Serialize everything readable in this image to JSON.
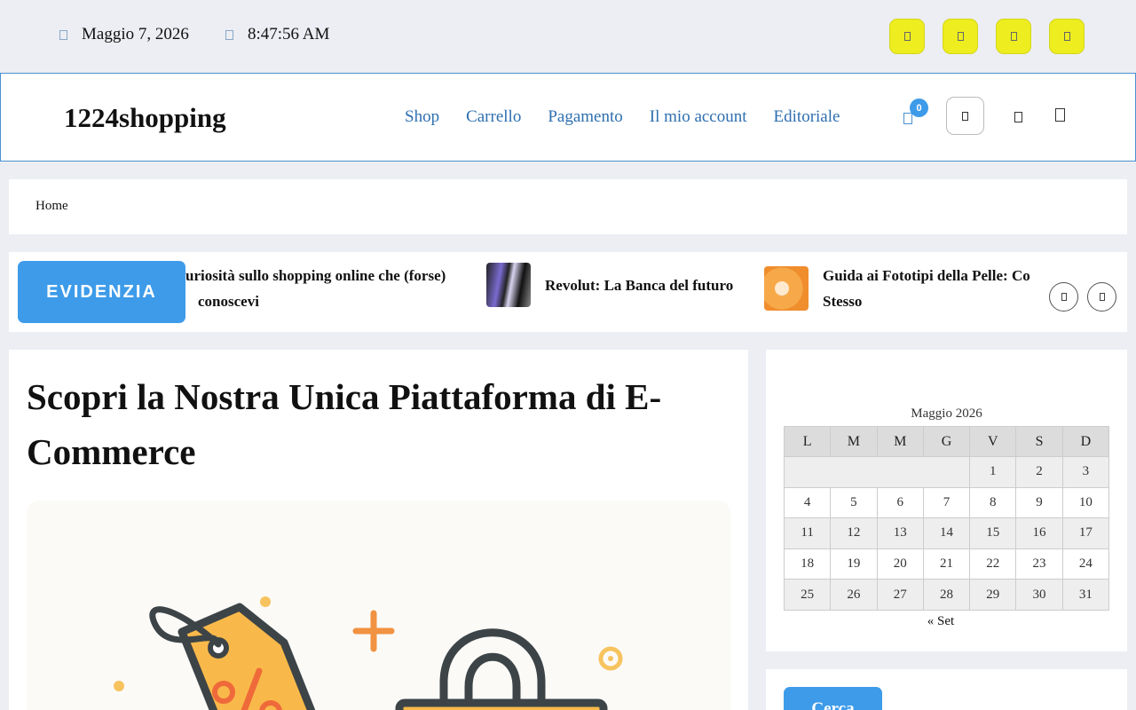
{
  "topbar": {
    "date": "Maggio 7, 2026",
    "time": "8:47:56 AM",
    "date_icon": "calendar-icon",
    "time_icon": "clock-icon",
    "social_icons": [
      "social-icon-1",
      "social-icon-2",
      "social-icon-3",
      "social-icon-4"
    ],
    "social_color": "#eded1f"
  },
  "header": {
    "logo": "1224shopping",
    "nav": [
      "Shop",
      "Carrello",
      "Pagamento",
      "Il mio account",
      "Editoriale"
    ],
    "cart_count": "0",
    "accent": "#3d9be9"
  },
  "breadcrumb": {
    "home": "Home"
  },
  "ticker": {
    "label": "EVIDENZIA",
    "items": [
      {
        "title": "Curiosità sullo shopping online che (forse) non conoscevi",
        "visible_text_1": "uriosità sullo shopping online che (forse)",
        "visible_text_2": "conoscevi"
      },
      {
        "title": "Revolut: La Banca del futuro"
      },
      {
        "title_line1": "Guida ai Fototipi della Pelle: Co",
        "title_line2": "Stesso"
      }
    ]
  },
  "main": {
    "title": "Scopri la Nostra Unica Piattaforma di E-Commerce"
  },
  "calendar": {
    "caption": "Maggio 2026",
    "weekdays": [
      "L",
      "M",
      "M",
      "G",
      "V",
      "S",
      "D"
    ],
    "weeks": [
      [
        "",
        "",
        "",
        "",
        "1",
        "2",
        "3"
      ],
      [
        "4",
        "5",
        "6",
        "7",
        "8",
        "9",
        "10"
      ],
      [
        "11",
        "12",
        "13",
        "14",
        "15",
        "16",
        "17"
      ],
      [
        "18",
        "19",
        "20",
        "21",
        "22",
        "23",
        "24"
      ],
      [
        "25",
        "26",
        "27",
        "28",
        "29",
        "30",
        "31"
      ]
    ],
    "prev_link": "« Set"
  },
  "sidebar2": {
    "button": "Cerca"
  }
}
